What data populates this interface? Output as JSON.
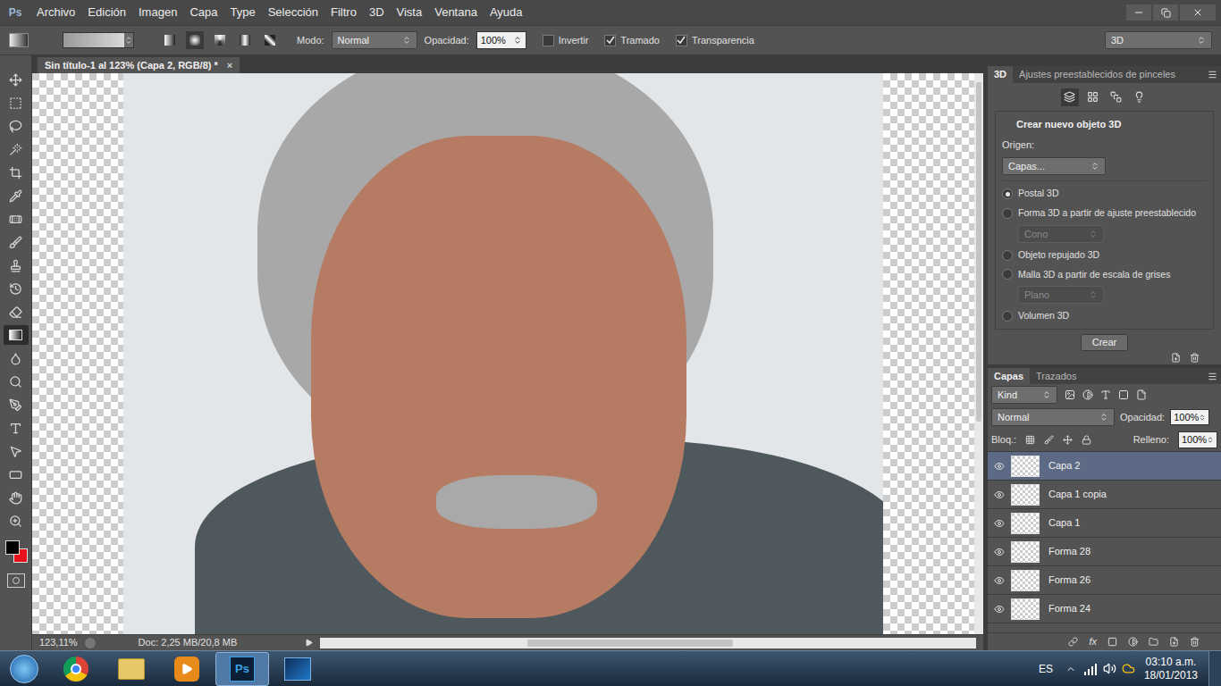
{
  "app": {
    "logo": "Ps",
    "menu": [
      "Archivo",
      "Edición",
      "Imagen",
      "Capa",
      "Type",
      "Selección",
      "Filtro",
      "3D",
      "Vista",
      "Ventana",
      "Ayuda"
    ]
  },
  "options_bar": {
    "mode_label": "Modo:",
    "mode": "Normal",
    "opacity_label": "Opacidad:",
    "opacity": "100%",
    "checkboxes": [
      {
        "label": "Invertir",
        "checked": false
      },
      {
        "label": "Tramado",
        "checked": true
      },
      {
        "label": "Transparencia",
        "checked": true
      }
    ],
    "workspace": "3D"
  },
  "document": {
    "tab": "Sin título-1 al 123% (Capa 2, RGB/8) *",
    "close": "×"
  },
  "tools": [
    {
      "kind": "move",
      "selected": false
    },
    {
      "kind": "marquee",
      "selected": false
    },
    {
      "kind": "lasso",
      "selected": false
    },
    {
      "kind": "wand",
      "selected": false
    },
    {
      "kind": "crop",
      "selected": false
    },
    {
      "kind": "eyedropper",
      "selected": false
    },
    {
      "kind": "healing",
      "selected": false
    },
    {
      "kind": "brush",
      "selected": false
    },
    {
      "kind": "stamp",
      "selected": false
    },
    {
      "kind": "history",
      "selected": false
    },
    {
      "kind": "eraser",
      "selected": false
    },
    {
      "kind": "gradient",
      "selected": true
    },
    {
      "kind": "blur",
      "selected": false
    },
    {
      "kind": "dodge",
      "selected": false
    },
    {
      "kind": "pen",
      "selected": false
    },
    {
      "kind": "type",
      "selected": false
    },
    {
      "kind": "pathselect",
      "selected": false
    },
    {
      "kind": "shape",
      "selected": false
    },
    {
      "kind": "hand",
      "selected": false
    },
    {
      "kind": "zoom",
      "selected": false
    }
  ],
  "swatches": {
    "foreground": "#000000",
    "background": "#e8101a"
  },
  "status_bar": {
    "zoom": "123,11%",
    "doc": "Doc: 2,25 MB/20,8 MB"
  },
  "panel_3d": {
    "tabs": [
      {
        "label": "3D",
        "selected": true
      },
      {
        "label": "Ajustes preestablecidos de pinceles",
        "selected": false
      }
    ],
    "title": "Crear nuevo objeto 3D",
    "source_label": "Origen:",
    "source": "Capas...",
    "options": [
      {
        "label": "Postal 3D",
        "selected": true
      },
      {
        "label": "Forma 3D a partir de ajuste preestablecido",
        "selected": false,
        "sub": {
          "value": "Cono",
          "disabled": true
        }
      },
      {
        "label": "Objeto repujado 3D",
        "selected": false
      },
      {
        "label": "Malla 3D a partir de escala de grises",
        "selected": false,
        "sub": {
          "value": "Plano",
          "disabled": true
        }
      },
      {
        "label": "Volumen 3D",
        "selected": false
      }
    ],
    "button": "Crear"
  },
  "layers_panel": {
    "tabs": [
      {
        "label": "Capas",
        "selected": true
      },
      {
        "label": "Trazados",
        "selected": false
      }
    ],
    "filter": "Kind",
    "blend": "Normal",
    "opacity_label": "Opacidad:",
    "opacity": "100%",
    "lock_label": "Bloq.:",
    "fill_label": "Relleno:",
    "fill": "100%",
    "layers": [
      {
        "name": "Capa 2",
        "visible": true,
        "selected": true
      },
      {
        "name": "Capa 1 copia",
        "visible": true,
        "selected": false
      },
      {
        "name": "Capa 1",
        "visible": true,
        "selected": false
      },
      {
        "name": "Forma 28",
        "visible": true,
        "selected": false
      },
      {
        "name": "Forma 26",
        "visible": true,
        "selected": false
      },
      {
        "name": "Forma 24",
        "visible": true,
        "selected": false
      }
    ],
    "fx_label": "fx"
  },
  "taskbar": {
    "apps": [
      {
        "kind": "chrome",
        "label": "",
        "active": false
      },
      {
        "kind": "explorer",
        "label": "",
        "active": false
      },
      {
        "kind": "media",
        "label": "",
        "active": false
      },
      {
        "kind": "photoshop",
        "label": "Ps",
        "active": true
      },
      {
        "kind": "other",
        "label": "",
        "active": false
      }
    ],
    "language": "ES",
    "time": "03:10 a.m.",
    "date": "18/01/2013"
  }
}
